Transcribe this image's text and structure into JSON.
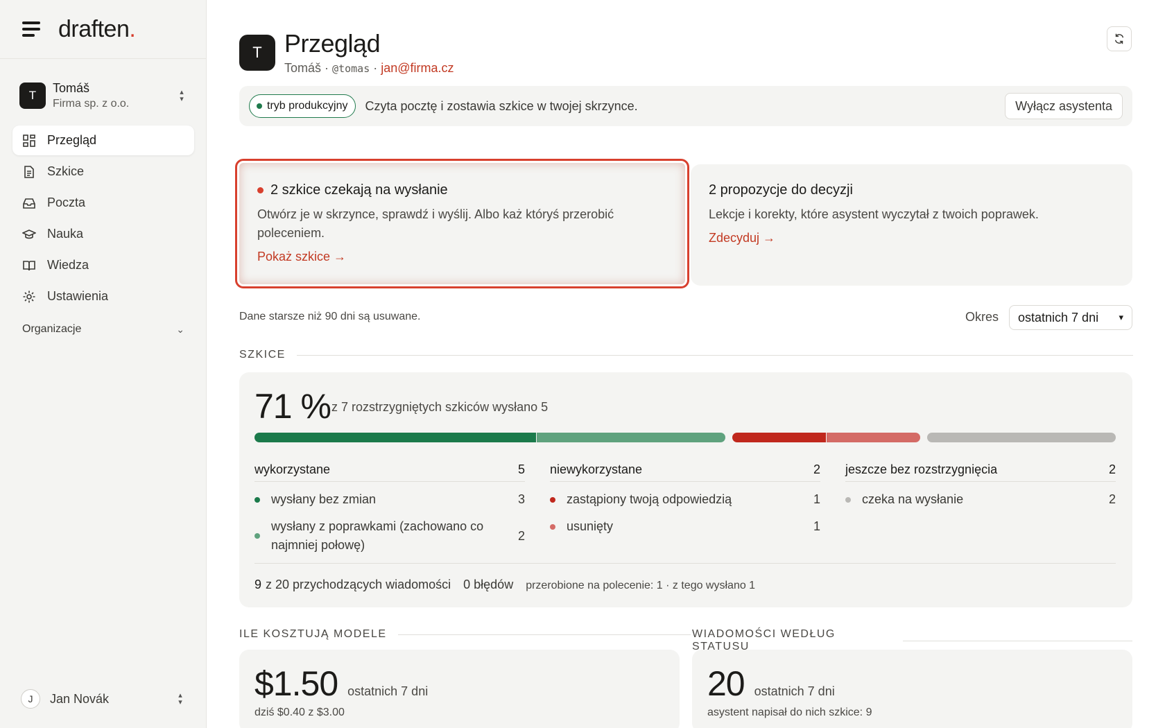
{
  "brand": {
    "name": "draften",
    "dot": "."
  },
  "workspace": {
    "avatar": "T",
    "name": "Tomáš",
    "org": "Firma sp. z o.o."
  },
  "nav": {
    "items": [
      {
        "label": "Przegląd",
        "icon": "grid-icon"
      },
      {
        "label": "Szkice",
        "icon": "document-icon"
      },
      {
        "label": "Poczta",
        "icon": "inbox-icon"
      },
      {
        "label": "Nauka",
        "icon": "graduation-cap-icon"
      },
      {
        "label": "Wiedza",
        "icon": "book-icon"
      },
      {
        "label": "Ustawienia",
        "icon": "gear-icon"
      }
    ],
    "organizations": "Organizacje"
  },
  "user": {
    "avatar": "J",
    "name": "Jan Novák"
  },
  "header": {
    "avatar": "T",
    "title": "Przegląd",
    "name": "Tomáš",
    "sep": "·",
    "handle": "@tomas",
    "email": "jan@firma.cz"
  },
  "banner": {
    "mode": "tryb produkcyjny",
    "text": "Czyta pocztę i zostawia szkice w twojej skrzynce.",
    "button": "Wyłącz asystenta"
  },
  "cards": {
    "drafts": {
      "title": "2 szkice czekają na wysłanie",
      "text": "Otwórz je w skrzynce, sprawdź i wyślij. Albo każ któryś przerobić poleceniem.",
      "link": "Pokaż szkice →"
    },
    "proposals": {
      "title": "2 propozycje do decyzji",
      "text": "Lekcje i korekty, które asystent wyczytał z twoich poprawek.",
      "link": "Zdecyduj →"
    }
  },
  "retention": "Dane starsze niż 90 dni są usuwane.",
  "period": {
    "label": "Okres",
    "value": "ostatnich 7 dni"
  },
  "sections": {
    "drafts": "SZKICE",
    "costs": "ILE KOSZTUJĄ MODELE",
    "messages": "WIADOMOŚCI WEDŁUG STATUSU"
  },
  "stats": {
    "percent": "71 %",
    "summary": "z 7 rozstrzygniętych szkiców wysłano 5",
    "bar": [
      {
        "value": 3,
        "color": "#1b7a4b"
      },
      {
        "value": 2,
        "color": "#5fa27e"
      },
      {
        "value": 1,
        "color": "#c0281d"
      },
      {
        "value": 1,
        "color": "#d46b66"
      },
      {
        "value": 2,
        "color": "#b9b8b5"
      }
    ],
    "columns": [
      {
        "title": "wykorzystane",
        "count": "5",
        "rows": [
          {
            "label": "wysłany bez zmian",
            "count": "3",
            "color": "#1b7a4b"
          },
          {
            "label": "wysłany z poprawkami (zachowano co najmniej połowę)",
            "count": "2",
            "color": "#5fa27e"
          }
        ]
      },
      {
        "title": "niewykorzystane",
        "count": "2",
        "rows": [
          {
            "label": "zastąpiony twoją odpowiedzią",
            "count": "1",
            "color": "#c0281d"
          },
          {
            "label": "usunięty",
            "count": "1",
            "color": "#d46b66"
          }
        ]
      },
      {
        "title": "jeszcze bez rozstrzygnięcia",
        "count": "2",
        "rows": [
          {
            "label": "czeka na wysłanie",
            "count": "2",
            "color": "#b9b8b5"
          }
        ]
      }
    ],
    "footer": {
      "processed": "9",
      "incoming": "z 20 przychodzących wiadomości",
      "errors": "0 błędów",
      "reworked": "przerobione na polecenie: 1 · z tego wysłano 1"
    }
  },
  "costs": {
    "value": "$1.50",
    "period": "ostatnich 7 dni",
    "today": "dziś $0.40 z $3.00"
  },
  "messages": {
    "value": "20",
    "period": "ostatnich 7 dni",
    "drafted": "asystent napisał do nich szkice: 9"
  }
}
